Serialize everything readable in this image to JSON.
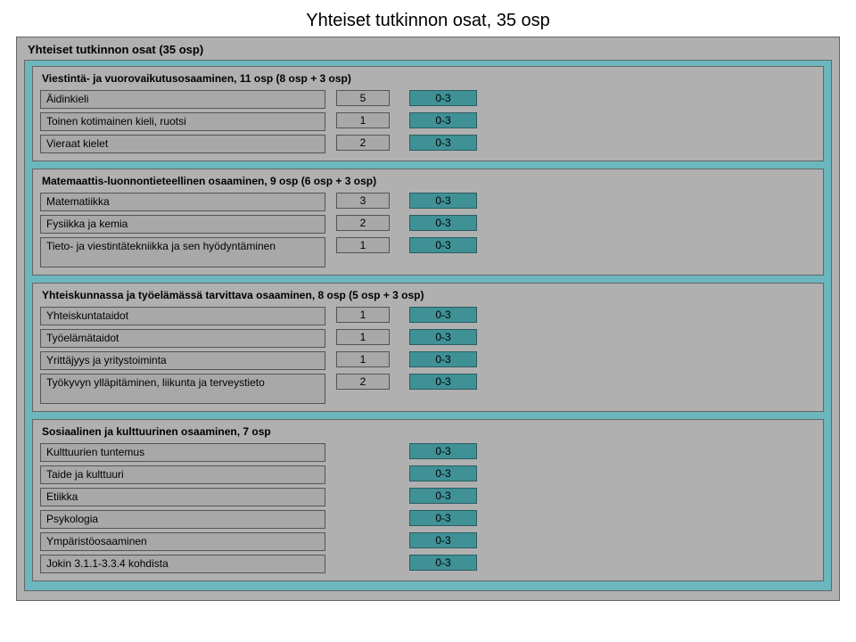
{
  "title": "Yhteiset tutkinnon osat, 35 osp",
  "outerLabel": "Yhteiset tutkinnon osat (35 osp)",
  "sections": [
    {
      "title": "Viestintä- ja vuorovaikutusosaaminen, 11 osp (8 osp + 3 osp)",
      "rows": [
        {
          "name": "Äidinkieli",
          "credits": "5",
          "range": "0-3"
        },
        {
          "name": "Toinen kotimainen kieli, ruotsi",
          "credits": "1",
          "range": "0-3"
        },
        {
          "name": "Vieraat kielet",
          "credits": "2",
          "range": "0-3"
        }
      ]
    },
    {
      "title": "Matemaattis-luonnontieteellinen osaaminen, 9 osp (6 osp + 3 osp)",
      "rows": [
        {
          "name": "Matematiikka",
          "credits": "3",
          "range": "0-3"
        },
        {
          "name": "Fysiikka ja kemia",
          "credits": "2",
          "range": "0-3"
        },
        {
          "name": "Tieto- ja viestintätekniikka ja sen hyödyntäminen",
          "credits": "1",
          "range": "0-3",
          "tall": true
        }
      ]
    },
    {
      "title": "Yhteiskunnassa ja työelämässä tarvittava osaaminen, 8 osp (5 osp + 3 osp)",
      "rows": [
        {
          "name": "Yhteiskuntataidot",
          "credits": "1",
          "range": "0-3"
        },
        {
          "name": "Työelämätaidot",
          "credits": "1",
          "range": "0-3"
        },
        {
          "name": "Yrittäjyys ja yritystoiminta",
          "credits": "1",
          "range": "0-3"
        },
        {
          "name": "Työkyvyn ylläpitäminen, liikunta ja terveystieto",
          "credits": "2",
          "range": "0-3",
          "tall": true
        }
      ]
    },
    {
      "title": "Sosiaalinen ja kulttuurinen osaaminen, 7 osp",
      "rows": [
        {
          "name": "Kulttuurien tuntemus",
          "range": "0-3"
        },
        {
          "name": "Taide ja kulttuuri",
          "range": "0-3"
        },
        {
          "name": "Etiikka",
          "range": "0-3"
        },
        {
          "name": "Psykologia",
          "range": "0-3"
        },
        {
          "name": "Ympäristöosaaminen",
          "range": "0-3"
        },
        {
          "name": "Jokin 3.1.1-3.3.4 kohdista",
          "range": "0-3"
        }
      ]
    }
  ]
}
